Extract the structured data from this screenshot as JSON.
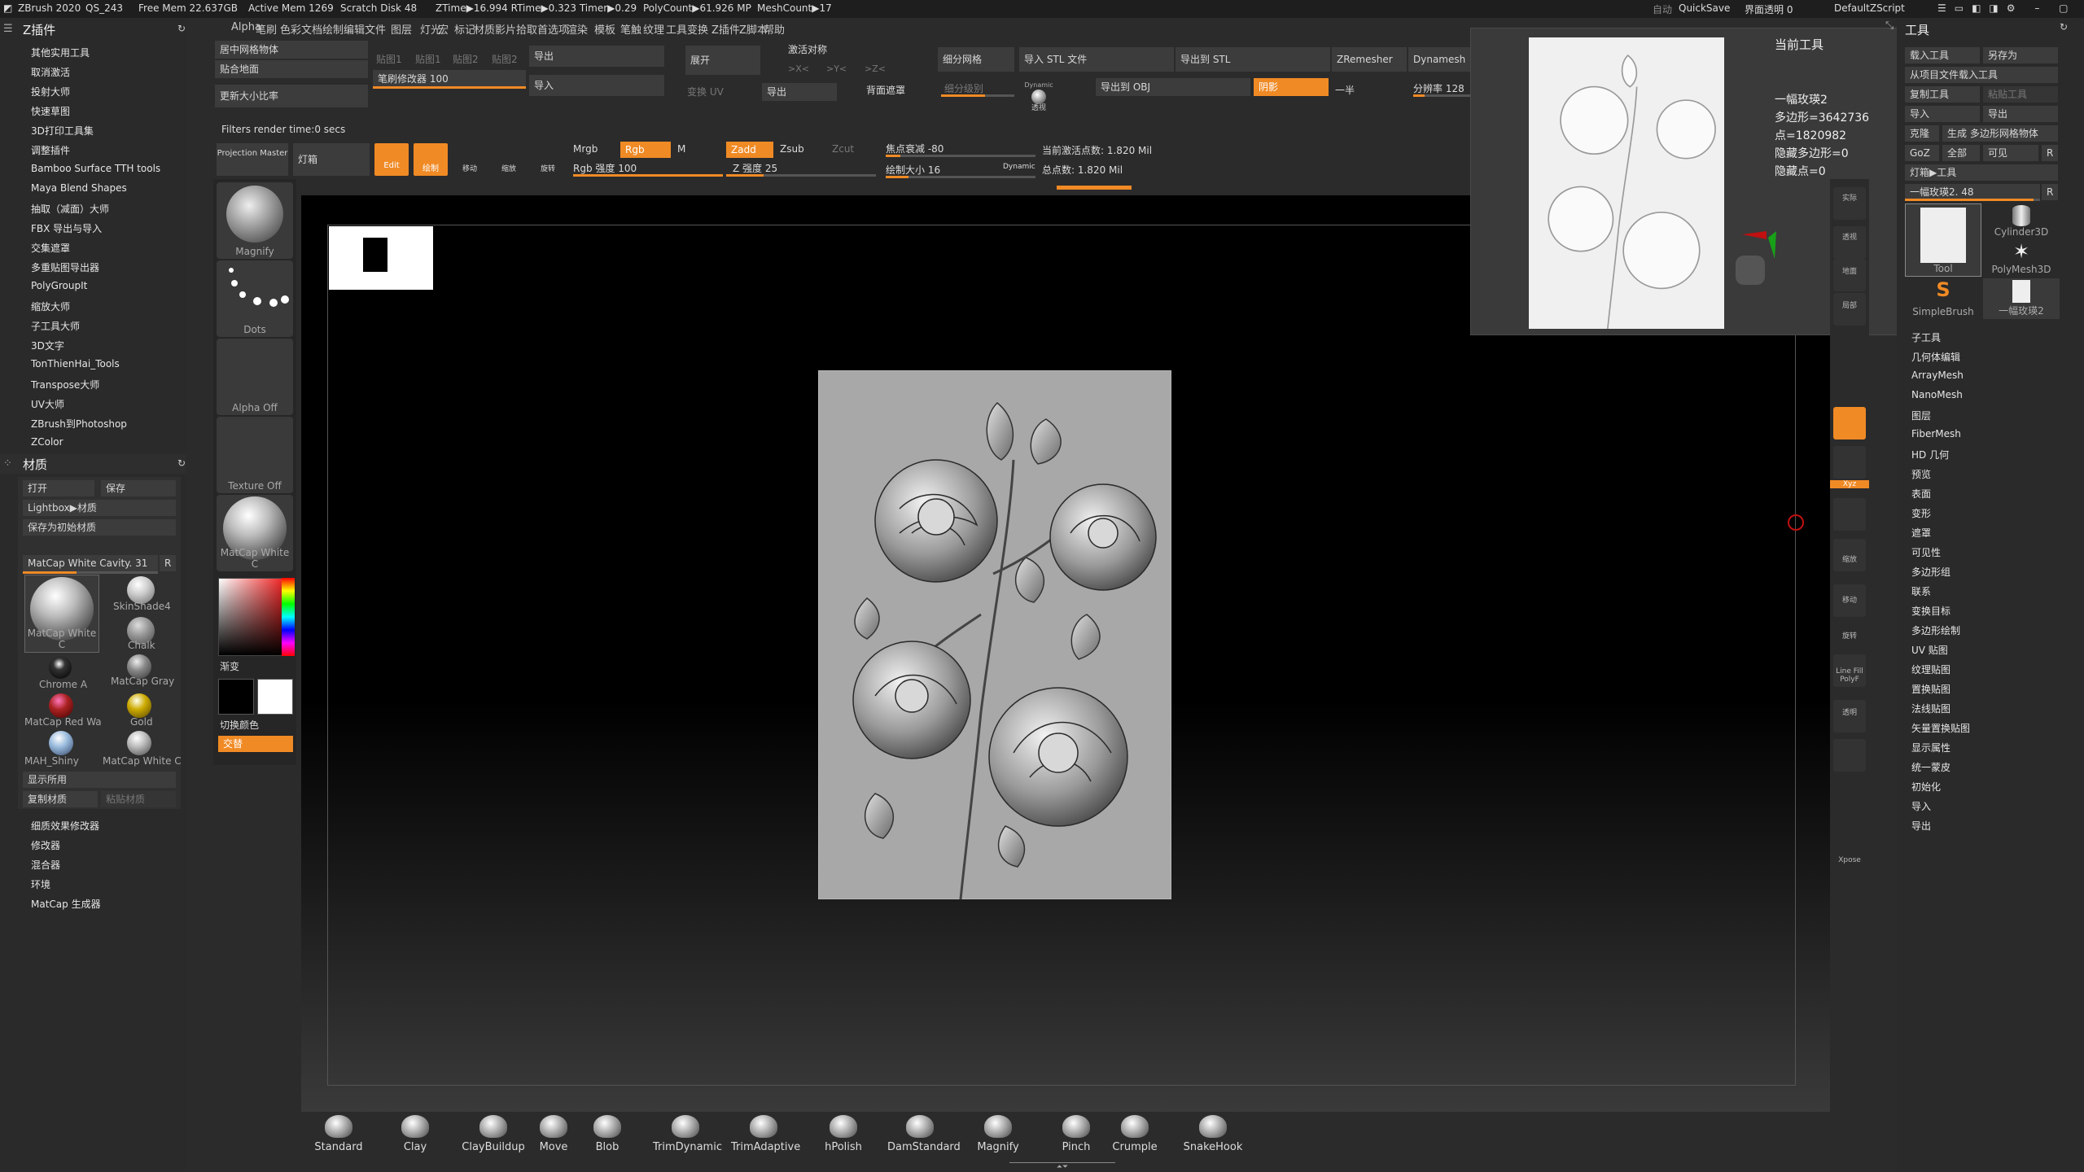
{
  "titlebar": {
    "app": "ZBrush 2020",
    "qs": "QS_243",
    "free_mem": "Free Mem 22.637GB",
    "active_mem": "Active Mem 1269",
    "scratch": "Scratch Disk 48",
    "ztime": "ZTime▶16.994 RTime▶0.323 Timer▶0.29",
    "polycount": "PolyCount▶61.926 MP",
    "meshcount": "MeshCount▶17",
    "auto": "自动",
    "quicksave": "QuickSave",
    "ui_transparency": "界面透明 0",
    "script": "DefaultZScript"
  },
  "menu": [
    "Alpha",
    "笔刷",
    "色彩",
    "文档",
    "绘制",
    "编辑",
    "文件",
    "图层",
    "灯光",
    "宏",
    "标记",
    "材质",
    "影片",
    "拾取",
    "首选项",
    "渲染",
    "模板",
    "笔触",
    "纹理",
    "工具",
    "变换",
    "Z插件",
    "Z脚本",
    "帮助"
  ],
  "zplugin": {
    "title": "Z插件",
    "items": [
      "其他实用工具",
      "取消激活",
      "投射大师",
      "快速草图",
      "3D打印工具集",
      "调整插件",
      "Bamboo Surface TTH tools",
      "Maya Blend Shapes",
      "抽取（减面）大师",
      "FBX 导出与导入",
      "交集遮罩",
      "多重贴图导出器",
      "PolyGroupIt",
      "缩放大师",
      "子工具大师",
      "3D文字",
      "TonThienHai_Tools",
      "Transpose大师",
      "UV大师",
      "ZBrush到Photoshop",
      "ZColor"
    ]
  },
  "material": {
    "title": "材质",
    "open": "打开",
    "save": "保存",
    "lightbox": "Lightbox▶材质",
    "save_init": "保存为初始材质",
    "current": "MatCap White Cavity. 31",
    "r": "R",
    "mats": [
      "MatCap White C",
      "SkinShade4",
      "Chalk",
      "Chrome A",
      "MatCap Gray",
      "MatCap Red Wa",
      "Gold",
      "MAH_Shiny",
      "MatCap White C"
    ],
    "show_used": "显示所用",
    "copy_mat": "复制材质",
    "paste_mat": "粘贴材质",
    "sub": [
      "细质效果修改器",
      "修改器",
      "混合器",
      "环境",
      "MatCap 生成器"
    ]
  },
  "shelf": {
    "brush": "Magnify",
    "stroke": "Dots",
    "alpha": "Alpha Off",
    "texture": "Texture Off",
    "material": "MatCap White C",
    "gradient": "渐变",
    "switch_color": "切换颜色",
    "alternate": "交替"
  },
  "top": {
    "center_mesh": "居中网格物体",
    "fit_ground": "贴合地面",
    "update_size": "更新大小比率",
    "map1": "贴图1",
    "map1b": "贴图1",
    "map2": "贴图2",
    "map2b": "贴图2",
    "brush_mod": "笔刷修改器 100",
    "export": "导出",
    "import": "导入",
    "unfold": "展开",
    "transform_uv": "变换 UV",
    "export2": "导出",
    "activate_sym": "激活对称",
    "x": ">X<",
    "y": ">Y<",
    "z": ">Z<",
    "back_mask": "背面遮罩",
    "subdivide": "细分网格",
    "sub_level": "细分级别",
    "import_stl": "导入 STL 文件",
    "export_stl": "导出到 STL",
    "export_obj": "导出到 OBJ",
    "shadow": "阴影",
    "zremesher": "ZRemesher",
    "half": "一半",
    "dynamesh": "Dynamesh",
    "resolution": "分辨率 128",
    "dynamic": "Dynamic",
    "persp": "透视",
    "filters": "Filters render time:0 secs",
    "projection_master": "Projection Master",
    "lightbox_btn": "灯箱",
    "edit": "Edit",
    "draw": "绘制",
    "move": "移动",
    "scale": "缩放",
    "rotate": "旋转",
    "mrgb": "Mrgb",
    "rgb": "Rgb",
    "m": "M",
    "rgb_intensity": "Rgb 强度 100",
    "zadd": "Zadd",
    "zsub": "Zsub",
    "zcut": "Zcut",
    "z_intensity": "Z 强度 25",
    "focal": "焦点衰减 -80",
    "draw_size": "绘制大小 16",
    "dynamic2": "Dynamic",
    "active_points": "当前激活点数: 1.820 Mil",
    "total_points": "总点数: 1.820 Mil"
  },
  "current_tool": {
    "title": "当前工具",
    "name": "一幅玫瑛2",
    "polys": "多边形=3642736",
    "points": "点=1820982",
    "hidden_polys": "隐藏多边形=0",
    "hidden_points": "隐藏点=0"
  },
  "tool_panel": {
    "title": "工具",
    "load": "载入工具",
    "save_as": "另存为",
    "load_project": "从项目文件载入工具",
    "copy_tool": "复制工具",
    "paste_tool": "粘贴工具",
    "import": "导入",
    "export": "导出",
    "clone": "克隆",
    "make_polymesh": "生成 多边形网格物体",
    "goz": "GoZ",
    "all": "全部",
    "visible": "可见",
    "r": "R",
    "lightbox_tool": "灯箱▶工具",
    "tool_slider": "一幅玫瑛2. 48",
    "thumbs": [
      "Tool",
      "Cylinder3D",
      "PolyMesh3D",
      "SimpleBrush",
      "一幅玫瑛2"
    ],
    "items": [
      "子工具",
      "几何体编辑",
      "ArrayMesh",
      "NanoMesh",
      "图层",
      "FiberMesh",
      "HD 几何",
      "预览",
      "表面",
      "变形",
      "遮罩",
      "可见性",
      "多边形组",
      "联系",
      "变换目标",
      "多边形绘制",
      "UV 贴图",
      "纹理贴图",
      "置换贴图",
      "法线贴图",
      "矢量置换贴图",
      "显示属性",
      "统一蒙皮",
      "初始化",
      "导入",
      "导出"
    ]
  },
  "vtools": [
    "实际",
    "透视",
    "地面",
    "局部",
    "Xyz",
    "缩放",
    "移动",
    "旋转",
    "Line Fill PolyF",
    "透明",
    "Xpose"
  ],
  "brushes": [
    "Standard",
    "Clay",
    "ClayBuildup",
    "Move",
    "Blob",
    "TrimDynamic",
    "TrimAdaptive",
    "hPolish",
    "DamStandard",
    "Magnify",
    "Pinch",
    "Crumple",
    "SnakeHook"
  ],
  "colors": {
    "accent": "#f08a25",
    "bg": "#2b2b2b",
    "canvas": "#000000"
  }
}
